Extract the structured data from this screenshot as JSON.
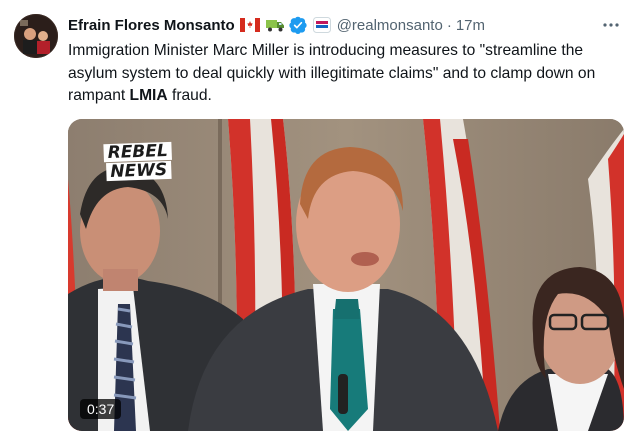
{
  "tweet": {
    "author_name": "Efrain Flores Monsanto",
    "handle": "@realmonsanto",
    "separator": "·",
    "time": "17m",
    "text_before": "Immigration Minister Marc Miller is introducing measures to \"streamline the asylum system to deal quickly with illegitimate claims\" and to clamp down on rampant ",
    "text_bold": "LMIA",
    "text_after": " fraud.",
    "author_emoji": [
      "canada-flag-icon",
      "truck-icon"
    ],
    "verified_icon": "verified-badge-icon",
    "more_icon": "more-options-icon"
  },
  "media": {
    "type": "video",
    "watermark_line1": "REBEL",
    "watermark_line2": "NEWS",
    "duration": "0:37"
  },
  "colors": {
    "text": "#0f1419",
    "secondary": "#536471",
    "verified": "#1d9bf0",
    "flag_red": "#d52b1e"
  }
}
